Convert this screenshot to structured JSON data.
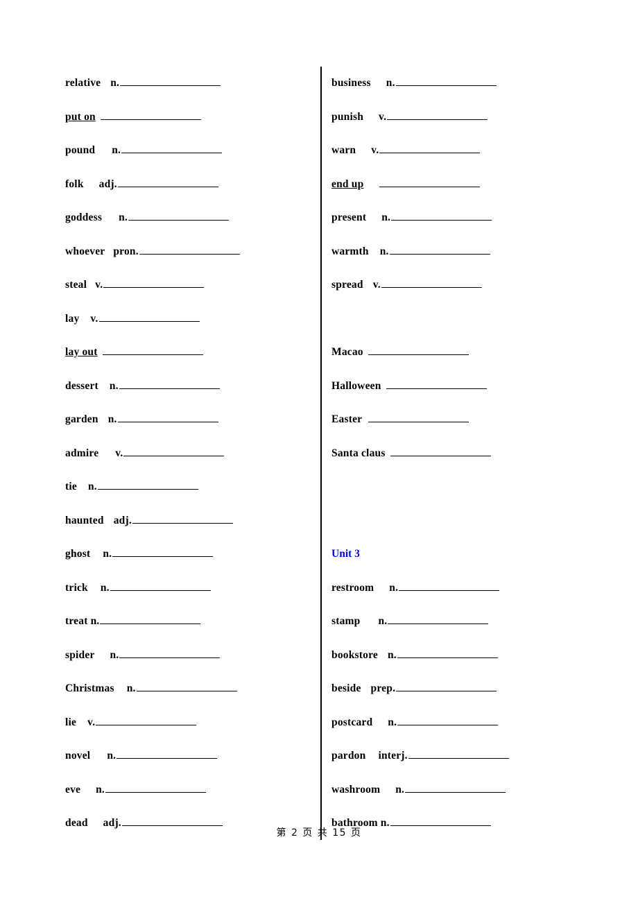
{
  "page": {
    "footer": "第 2 页 共 15 页",
    "divider_color": "#000000",
    "unit_heading_color": "#0000ee"
  },
  "left_column": {
    "entries": [
      {
        "word": "relative",
        "pos": "n.",
        "phrasal": false,
        "word_gap": 14,
        "blank": false
      },
      {
        "word": "put on",
        "pos": "",
        "phrasal": true,
        "word_gap": 6,
        "blank": false
      },
      {
        "word": "pound",
        "pos": "n.",
        "phrasal": false,
        "word_gap": 24,
        "blank": false
      },
      {
        "word": "folk",
        "pos": "adj.",
        "phrasal": false,
        "word_gap": 22,
        "blank": false
      },
      {
        "word": "goddess",
        "pos": "n.",
        "phrasal": false,
        "word_gap": 24,
        "blank": false
      },
      {
        "word": "whoever",
        "pos": "pron.",
        "phrasal": false,
        "word_gap": 12,
        "blank": false
      },
      {
        "word": "steal",
        "pos": "v.",
        "phrasal": false,
        "word_gap": 12,
        "blank": false
      },
      {
        "word": "lay",
        "pos": "v.",
        "phrasal": false,
        "word_gap": 16,
        "blank": false
      },
      {
        "word": "lay out",
        "pos": "",
        "phrasal": true,
        "word_gap": 6,
        "blank": false
      },
      {
        "word": "dessert",
        "pos": "n.",
        "phrasal": false,
        "word_gap": 16,
        "blank": false
      },
      {
        "word": "garden",
        "pos": "n.",
        "phrasal": false,
        "word_gap": 14,
        "blank": false
      },
      {
        "word": "admire",
        "pos": "v.",
        "phrasal": false,
        "word_gap": 24,
        "blank": false
      },
      {
        "word": "tie",
        "pos": "n.",
        "phrasal": false,
        "word_gap": 16,
        "blank": false
      },
      {
        "word": "haunted",
        "pos": "adj.",
        "phrasal": false,
        "word_gap": 14,
        "blank": false
      },
      {
        "word": "ghost",
        "pos": "n.",
        "phrasal": false,
        "word_gap": 18,
        "blank": false
      },
      {
        "word": "trick",
        "pos": "n.",
        "phrasal": false,
        "word_gap": 18,
        "blank": false
      },
      {
        "word": "treat",
        "pos": "n.",
        "phrasal": false,
        "word_gap": 4,
        "blank": false
      },
      {
        "word": "spider",
        "pos": "n.",
        "phrasal": false,
        "word_gap": 22,
        "blank": false
      },
      {
        "word": "Christmas",
        "pos": "n.",
        "phrasal": false,
        "word_gap": 18,
        "blank": false
      },
      {
        "word": "lie",
        "pos": "v.",
        "phrasal": false,
        "word_gap": 16,
        "blank": false
      },
      {
        "word": "novel",
        "pos": "n.",
        "phrasal": false,
        "word_gap": 24,
        "blank": false
      },
      {
        "word": "eve",
        "pos": "n.",
        "phrasal": false,
        "word_gap": 22,
        "blank": false
      },
      {
        "word": "dead",
        "pos": "adj.",
        "phrasal": false,
        "word_gap": 22,
        "blank": false
      }
    ]
  },
  "right_column": {
    "entries": [
      {
        "word": "business",
        "pos": "n.",
        "phrasal": false,
        "word_gap": 22,
        "blank": false,
        "type": "entry"
      },
      {
        "word": "punish",
        "pos": "v.",
        "phrasal": false,
        "word_gap": 22,
        "blank": false,
        "type": "entry"
      },
      {
        "word": "warn",
        "pos": "v.",
        "phrasal": false,
        "word_gap": 22,
        "blank": false,
        "type": "entry"
      },
      {
        "word": "end up",
        "pos": "",
        "phrasal": true,
        "word_gap": 22,
        "blank": false,
        "type": "entry"
      },
      {
        "word": "present",
        "pos": "n.",
        "phrasal": false,
        "word_gap": 22,
        "blank": false,
        "type": "entry"
      },
      {
        "word": "warmth",
        "pos": "n.",
        "phrasal": false,
        "word_gap": 16,
        "blank": false,
        "type": "entry"
      },
      {
        "word": "spread",
        "pos": "v.",
        "phrasal": false,
        "word_gap": 14,
        "blank": false,
        "type": "entry"
      },
      {
        "word": "",
        "pos": "",
        "phrasal": false,
        "word_gap": 0,
        "blank": true,
        "type": "spacer"
      },
      {
        "word": "Macao",
        "pos": "",
        "phrasal": false,
        "word_gap": 6,
        "blank": false,
        "type": "entry"
      },
      {
        "word": "Halloween",
        "pos": "",
        "phrasal": false,
        "word_gap": 6,
        "blank": false,
        "type": "entry"
      },
      {
        "word": "Easter",
        "pos": "",
        "phrasal": false,
        "word_gap": 8,
        "blank": false,
        "type": "entry"
      },
      {
        "word": "Santa claus",
        "pos": "",
        "phrasal": false,
        "word_gap": 6,
        "blank": false,
        "type": "entry"
      },
      {
        "word": "",
        "pos": "",
        "phrasal": false,
        "word_gap": 0,
        "blank": true,
        "type": "spacer"
      },
      {
        "word": "",
        "pos": "",
        "phrasal": false,
        "word_gap": 0,
        "blank": true,
        "type": "spacer"
      },
      {
        "word": "Unit 3",
        "pos": "",
        "phrasal": false,
        "word_gap": 0,
        "blank": false,
        "type": "unit-heading"
      },
      {
        "word": "restroom",
        "pos": "n.",
        "phrasal": false,
        "word_gap": 22,
        "blank": false,
        "type": "entry"
      },
      {
        "word": "stamp",
        "pos": "n.",
        "phrasal": false,
        "word_gap": 26,
        "blank": false,
        "type": "entry"
      },
      {
        "word": "bookstore",
        "pos": "n.",
        "phrasal": false,
        "word_gap": 14,
        "blank": false,
        "type": "entry"
      },
      {
        "word": "beside",
        "pos": "prep.",
        "phrasal": false,
        "word_gap": 14,
        "blank": false,
        "type": "entry"
      },
      {
        "word": "postcard",
        "pos": "n.",
        "phrasal": false,
        "word_gap": 22,
        "blank": false,
        "type": "entry"
      },
      {
        "word": "pardon",
        "pos": "interj.",
        "phrasal": false,
        "word_gap": 18,
        "blank": false,
        "type": "entry"
      },
      {
        "word": "washroom",
        "pos": "n.",
        "phrasal": false,
        "word_gap": 22,
        "blank": false,
        "type": "entry"
      },
      {
        "word": "bathroom",
        "pos": "n.",
        "phrasal": false,
        "word_gap": 4,
        "blank": false,
        "type": "entry"
      }
    ]
  }
}
